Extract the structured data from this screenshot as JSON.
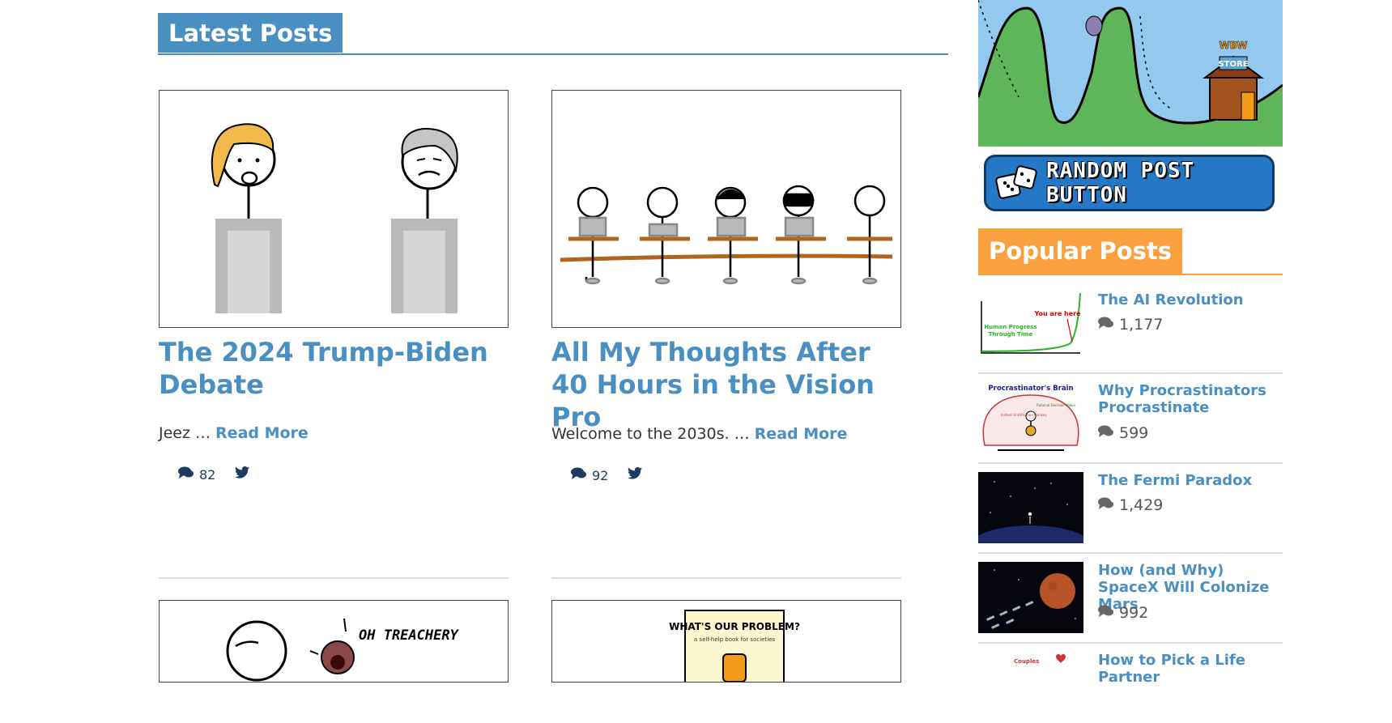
{
  "latest": {
    "heading": "Latest Posts"
  },
  "posts": [
    {
      "title": "The 2024 Trump-Biden Debate",
      "excerpt": "Jeez …",
      "read_more": "Read More",
      "comments": "82"
    },
    {
      "title": "All My Thoughts After 40 Hours in the Vision Pro",
      "excerpt": "Welcome to the 2030s. …",
      "read_more": "Read More",
      "comments": "92"
    }
  ],
  "bottom_thumbs": {
    "treachery_caption": "OH TREACHERY",
    "book_title": "WHAT'S OUR PROBLEM?",
    "book_subtitle": "a self-help book for societies"
  },
  "sidebar": {
    "store_sign_top": "WBW",
    "store_sign": "STORE",
    "random_button": "RANDOM POST BUTTON",
    "popular_heading": "Popular Posts",
    "popular": [
      {
        "title": "The AI Revolution",
        "count": "1,177",
        "thumb_labels": [
          "You are here",
          "Human Progress",
          "Through Time"
        ]
      },
      {
        "title": "Why Procrastinators Procrastinate",
        "count": "599",
        "thumb_labels": [
          "Procrastinator's Brain",
          "Rational Decision-Maker",
          "Instant Gratification Monkey"
        ]
      },
      {
        "title": "The Fermi Paradox",
        "count": "1,429"
      },
      {
        "title": "How (and Why) SpaceX Will Colonize Mars",
        "count": "992"
      },
      {
        "title": "How to Pick a Life Partner",
        "thumb_labels": [
          "Couples"
        ]
      }
    ]
  },
  "colors": {
    "accent": "#4a8fc2",
    "popular": "#f9a03f",
    "random_btn": "#2478c6"
  },
  "icons": {
    "comments": "comments-icon",
    "twitter": "twitter-icon"
  }
}
